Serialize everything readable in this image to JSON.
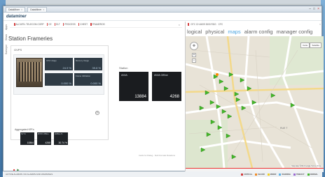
{
  "titlebar": {
    "tabs": [
      {
        "label": "DataMiner"
      },
      {
        "label": "DataMiner"
      }
    ]
  },
  "app": {
    "logo": "dataminer"
  },
  "vnav": {
    "items": [
      "Apps",
      "Views",
      "Surveyor"
    ]
  },
  "cards": [
    {
      "label": "ALCATEL TELECOM CORP"
    },
    {
      "label": "CE"
    },
    {
      "label": "ELT"
    },
    {
      "label": "PROCESS"
    },
    {
      "label": "CHEST"
    },
    {
      "label": "FRAMEROS"
    }
  ],
  "page": {
    "title": "Station Frameries"
  },
  "gvps": {
    "label": "GVPS",
    "kpis": [
      {
        "label": "CPU Usage",
        "value": "24.9 %"
      },
      {
        "label": "Memory Usage",
        "value": "39.8 %"
      },
      {
        "label": "",
        "value": "0.000 %"
      },
      {
        "label": "Frame Utilization",
        "value": "0.000 %"
      }
    ]
  },
  "aggregated": {
    "label": "Aggregated KPI's",
    "kpis": [
      {
        "label": "NV %",
        "value": "10864"
      },
      {
        "label": "#NV% Offline",
        "value": "4268"
      },
      {
        "label": "#offline %",
        "value": "30.74 %"
      }
    ]
  },
  "station": {
    "label": "Station",
    "kpis": [
      {
        "label": "#NVA",
        "value": "13884"
      },
      {
        "label": "#NVA Offline",
        "value": "4268"
      }
    ]
  },
  "footer": {
    "text": "Cards for Dialog - Sold Formats Rotations"
  },
  "map_toolbar": {
    "items": [
      "DTC CH-6009 3000 RDG",
      "CFC"
    ]
  },
  "view_tabs": {
    "items": [
      "logical",
      "physical",
      "maps",
      "alarm config",
      "manager config"
    ],
    "active": "maps"
  },
  "map": {
    "types": [
      "Carte",
      "Satellite"
    ],
    "road_label": "RUE T",
    "copyright": "Map data ©2014 Google  Terms of Use",
    "marker_color": "#44b82a"
  },
  "statusbar": {
    "text": "ACTIVE ALARMS: NO ALARMS AND WARNINGS",
    "legend": [
      {
        "label": "CRITICAL",
        "color": "#d43c3c"
      },
      {
        "label": "MAJOR",
        "color": "#f08a24"
      },
      {
        "label": "MINOR",
        "color": "#f2d024"
      },
      {
        "label": "WARNING",
        "color": "#5db3e8"
      },
      {
        "label": "TIMEOUT",
        "color": "#9b6ad1"
      },
      {
        "label": "NORMAL",
        "color": "#44b82a"
      }
    ]
  }
}
